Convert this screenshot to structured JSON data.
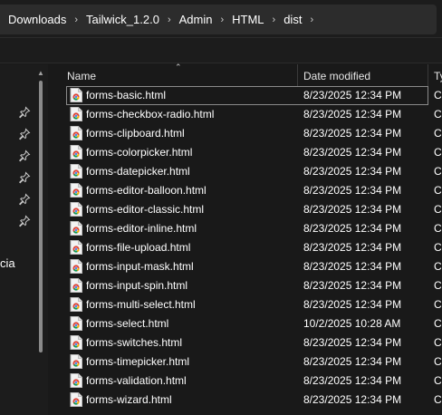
{
  "breadcrumb": [
    "Downloads",
    "Tailwick_1.2.0",
    "Admin",
    "HTML",
    "dist"
  ],
  "nav": {
    "partial_item": "cia",
    "pinned_count": 6
  },
  "columns": {
    "name": "Name",
    "date": "Date modified",
    "type": "Ty"
  },
  "files": [
    {
      "name": "forms-basic.html",
      "date": "8/23/2025 12:34 PM",
      "type": "C"
    },
    {
      "name": "forms-checkbox-radio.html",
      "date": "8/23/2025 12:34 PM",
      "type": "C"
    },
    {
      "name": "forms-clipboard.html",
      "date": "8/23/2025 12:34 PM",
      "type": "C"
    },
    {
      "name": "forms-colorpicker.html",
      "date": "8/23/2025 12:34 PM",
      "type": "C"
    },
    {
      "name": "forms-datepicker.html",
      "date": "8/23/2025 12:34 PM",
      "type": "C"
    },
    {
      "name": "forms-editor-balloon.html",
      "date": "8/23/2025 12:34 PM",
      "type": "C"
    },
    {
      "name": "forms-editor-classic.html",
      "date": "8/23/2025 12:34 PM",
      "type": "C"
    },
    {
      "name": "forms-editor-inline.html",
      "date": "8/23/2025 12:34 PM",
      "type": "C"
    },
    {
      "name": "forms-file-upload.html",
      "date": "8/23/2025 12:34 PM",
      "type": "C"
    },
    {
      "name": "forms-input-mask.html",
      "date": "8/23/2025 12:34 PM",
      "type": "C"
    },
    {
      "name": "forms-input-spin.html",
      "date": "8/23/2025 12:34 PM",
      "type": "C"
    },
    {
      "name": "forms-multi-select.html",
      "date": "8/23/2025 12:34 PM",
      "type": "C"
    },
    {
      "name": "forms-select.html",
      "date": "10/2/2025 10:28 AM",
      "type": "C"
    },
    {
      "name": "forms-switches.html",
      "date": "8/23/2025 12:34 PM",
      "type": "C"
    },
    {
      "name": "forms-timepicker.html",
      "date": "8/23/2025 12:34 PM",
      "type": "C"
    },
    {
      "name": "forms-validation.html",
      "date": "8/23/2025 12:34 PM",
      "type": "C"
    },
    {
      "name": "forms-wizard.html",
      "date": "8/23/2025 12:34 PM",
      "type": "C"
    }
  ],
  "icons": {
    "file": "chrome-html-file-icon",
    "pin": "pin-icon",
    "sort": "sort-ascending-icon",
    "chevron": "chevron-right-icon"
  },
  "colors": {
    "background": "#191919",
    "chrome_red": "#db4437",
    "chrome_green": "#0f9d58",
    "chrome_yellow": "#f4b400",
    "chrome_blue": "#4285f4"
  }
}
